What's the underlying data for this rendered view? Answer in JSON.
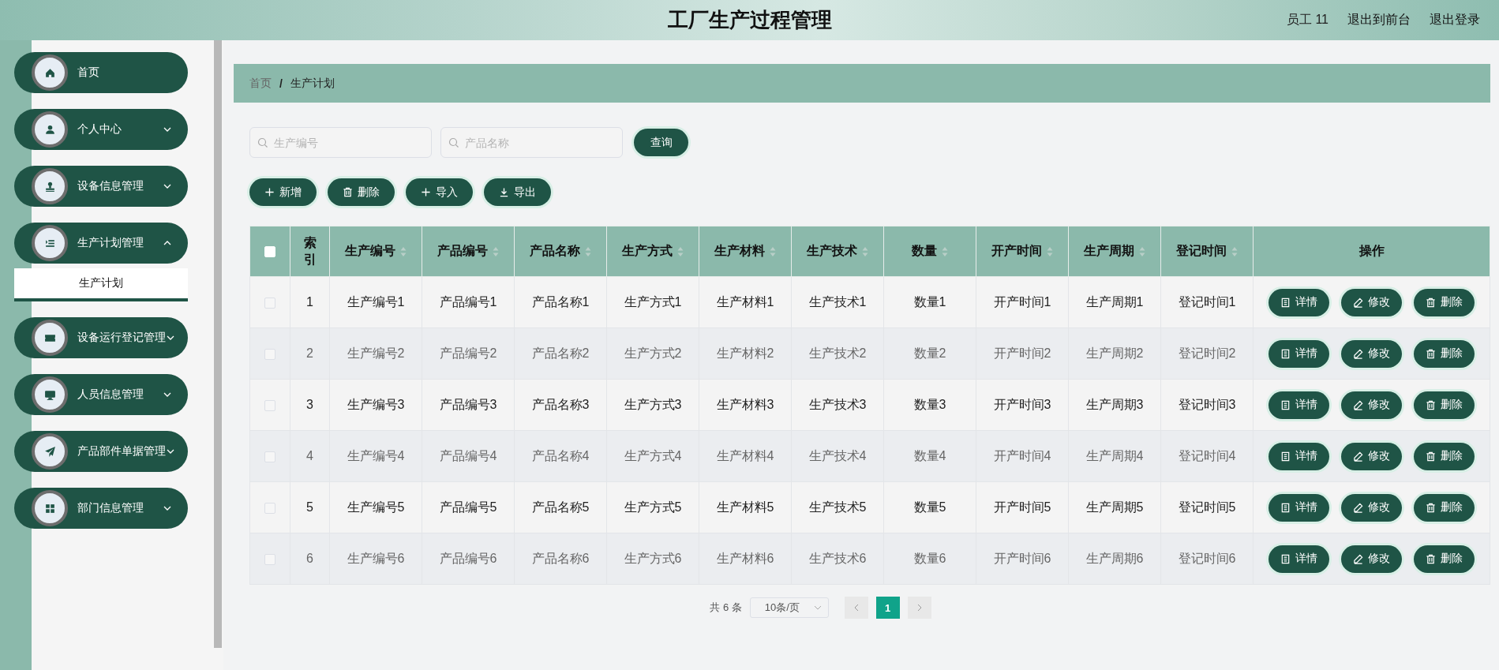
{
  "header": {
    "title": "工厂生产过程管理",
    "user": "员工 11",
    "links": [
      "退出到前台",
      "退出登录"
    ]
  },
  "sidebar": {
    "items": [
      {
        "label": "首页",
        "kind": "link"
      },
      {
        "label": "个人中心",
        "kind": "menu",
        "expanded": false
      },
      {
        "label": "设备信息管理",
        "kind": "menu",
        "expanded": false
      },
      {
        "label": "生产计划管理",
        "kind": "menu",
        "expanded": true,
        "children": [
          {
            "label": "生产计划",
            "selected": true
          }
        ]
      },
      {
        "label": "设备运行登记管理",
        "kind": "menu",
        "expanded": false
      },
      {
        "label": "人员信息管理",
        "kind": "menu",
        "expanded": false
      },
      {
        "label": "产品部件单据管理",
        "kind": "menu",
        "expanded": false
      },
      {
        "label": "部门信息管理",
        "kind": "menu",
        "expanded": false
      }
    ]
  },
  "breadcrumb": {
    "items": [
      "首页",
      "生产计划"
    ],
    "separator": "/"
  },
  "search": {
    "fields": [
      {
        "placeholder": "生产编号"
      },
      {
        "placeholder": "产品名称"
      }
    ],
    "button": "查询"
  },
  "toolbar": [
    {
      "label": "新增",
      "kind": "add"
    },
    {
      "label": "删除",
      "kind": "delete"
    },
    {
      "label": "导入",
      "kind": "add"
    },
    {
      "label": "导出",
      "kind": "export"
    }
  ],
  "table": {
    "checked": false,
    "columns": [
      {
        "label": "索引",
        "sortable": false
      },
      {
        "label": "生产编号",
        "sortable": true
      },
      {
        "label": "产品编号",
        "sortable": true
      },
      {
        "label": "产品名称",
        "sortable": true
      },
      {
        "label": "生产方式",
        "sortable": true
      },
      {
        "label": "生产材料",
        "sortable": true
      },
      {
        "label": "生产技术",
        "sortable": true
      },
      {
        "label": "数量",
        "sortable": true
      },
      {
        "label": "开产时间",
        "sortable": true
      },
      {
        "label": "生产周期",
        "sortable": true
      },
      {
        "label": "登记时间",
        "sortable": true
      },
      {
        "label": "操作",
        "sortable": false
      }
    ],
    "rows": [
      {
        "checked": false,
        "cells": [
          "1",
          "生产编号1",
          "产品编号1",
          "产品名称1",
          "生产方式1",
          "生产材料1",
          "生产技术1",
          "数量1",
          "开产时间1",
          "生产周期1",
          "登记时间1"
        ],
        "actions": [
          {
            "label": "详情",
            "kind": "detail"
          },
          {
            "label": "修改",
            "kind": "edit"
          },
          {
            "label": "删除",
            "kind": "delete"
          }
        ]
      },
      {
        "checked": false,
        "cells": [
          "2",
          "生产编号2",
          "产品编号2",
          "产品名称2",
          "生产方式2",
          "生产材料2",
          "生产技术2",
          "数量2",
          "开产时间2",
          "生产周期2",
          "登记时间2"
        ],
        "actions": [
          {
            "label": "详情",
            "kind": "detail"
          },
          {
            "label": "修改",
            "kind": "edit"
          },
          {
            "label": "删除",
            "kind": "delete"
          }
        ]
      },
      {
        "checked": false,
        "cells": [
          "3",
          "生产编号3",
          "产品编号3",
          "产品名称3",
          "生产方式3",
          "生产材料3",
          "生产技术3",
          "数量3",
          "开产时间3",
          "生产周期3",
          "登记时间3"
        ],
        "actions": [
          {
            "label": "详情",
            "kind": "detail"
          },
          {
            "label": "修改",
            "kind": "edit"
          },
          {
            "label": "删除",
            "kind": "delete"
          }
        ]
      },
      {
        "checked": false,
        "cells": [
          "4",
          "生产编号4",
          "产品编号4",
          "产品名称4",
          "生产方式4",
          "生产材料4",
          "生产技术4",
          "数量4",
          "开产时间4",
          "生产周期4",
          "登记时间4"
        ],
        "actions": [
          {
            "label": "详情",
            "kind": "detail"
          },
          {
            "label": "修改",
            "kind": "edit"
          },
          {
            "label": "删除",
            "kind": "delete"
          }
        ]
      },
      {
        "checked": false,
        "cells": [
          "5",
          "生产编号5",
          "产品编号5",
          "产品名称5",
          "生产方式5",
          "生产材料5",
          "生产技术5",
          "数量5",
          "开产时间5",
          "生产周期5",
          "登记时间5"
        ],
        "actions": [
          {
            "label": "详情",
            "kind": "detail"
          },
          {
            "label": "修改",
            "kind": "edit"
          },
          {
            "label": "删除",
            "kind": "delete"
          }
        ]
      },
      {
        "checked": false,
        "cells": [
          "6",
          "生产编号6",
          "产品编号6",
          "产品名称6",
          "生产方式6",
          "生产材料6",
          "生产技术6",
          "数量6",
          "开产时间6",
          "生产周期6",
          "登记时间6"
        ],
        "actions": [
          {
            "label": "详情",
            "kind": "detail"
          },
          {
            "label": "修改",
            "kind": "edit"
          },
          {
            "label": "删除",
            "kind": "delete"
          }
        ]
      }
    ]
  },
  "pagination": {
    "total": "共 6 条",
    "page_size": "10条/页",
    "pages": [
      {
        "label": "1",
        "selected": true
      }
    ]
  }
}
